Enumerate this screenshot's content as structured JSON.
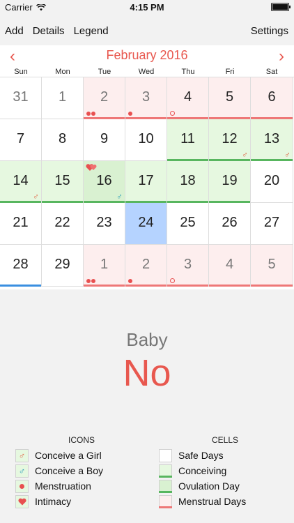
{
  "status": {
    "carrier": "Carrier",
    "time": "4:15 PM"
  },
  "nav": {
    "add": "Add",
    "details": "Details",
    "legend": "Legend",
    "settings": "Settings"
  },
  "calendar": {
    "month_title": "February 2016",
    "weekdays": [
      "Sun",
      "Mon",
      "Tue",
      "Wed",
      "Thu",
      "Fri",
      "Sat"
    ],
    "days": [
      {
        "n": "31",
        "type": "safe",
        "current": false
      },
      {
        "n": "1",
        "type": "safe",
        "current": false
      },
      {
        "n": "2",
        "type": "menstrual",
        "current": false,
        "dots": "two",
        "bar": "red"
      },
      {
        "n": "3",
        "type": "menstrual",
        "current": false,
        "dots": "one",
        "bar": "red"
      },
      {
        "n": "4",
        "type": "menstrual",
        "current": true,
        "dots": "hollow",
        "bar": "red"
      },
      {
        "n": "5",
        "type": "menstrual",
        "current": true,
        "bar": "red"
      },
      {
        "n": "6",
        "type": "menstrual",
        "current": true,
        "bar": "red"
      },
      {
        "n": "7",
        "type": "safe",
        "current": true
      },
      {
        "n": "8",
        "type": "safe",
        "current": true
      },
      {
        "n": "9",
        "type": "safe",
        "current": true
      },
      {
        "n": "10",
        "type": "safe",
        "current": true
      },
      {
        "n": "11",
        "type": "conceiving",
        "current": true,
        "bar": "green"
      },
      {
        "n": "12",
        "type": "conceiving",
        "current": true,
        "bar": "green",
        "gender": "girl"
      },
      {
        "n": "13",
        "type": "conceiving",
        "current": true,
        "bar": "green",
        "gender": "girl"
      },
      {
        "n": "14",
        "type": "conceiving",
        "current": true,
        "bar": "green",
        "gender": "girl"
      },
      {
        "n": "15",
        "type": "conceiving",
        "current": true,
        "bar": "green"
      },
      {
        "n": "16",
        "type": "ovulation",
        "current": true,
        "bar": "green",
        "gender": "boy",
        "hearts": true
      },
      {
        "n": "17",
        "type": "conceiving",
        "current": true,
        "bar": "green"
      },
      {
        "n": "18",
        "type": "conceiving",
        "current": true,
        "bar": "green"
      },
      {
        "n": "19",
        "type": "conceiving",
        "current": true,
        "bar": "green"
      },
      {
        "n": "20",
        "type": "safe",
        "current": true
      },
      {
        "n": "21",
        "type": "safe",
        "current": true
      },
      {
        "n": "22",
        "type": "safe",
        "current": true
      },
      {
        "n": "23",
        "type": "safe",
        "current": true
      },
      {
        "n": "24",
        "type": "today",
        "current": true
      },
      {
        "n": "25",
        "type": "safe",
        "current": true
      },
      {
        "n": "26",
        "type": "safe",
        "current": true
      },
      {
        "n": "27",
        "type": "safe",
        "current": true
      },
      {
        "n": "28",
        "type": "safe",
        "current": true,
        "bar": "blue",
        "bold": true
      },
      {
        "n": "29",
        "type": "safe",
        "current": true
      },
      {
        "n": "1",
        "type": "menstrual",
        "current": false,
        "dots": "two",
        "bar": "red"
      },
      {
        "n": "2",
        "type": "menstrual",
        "current": false,
        "dots": "one",
        "bar": "red"
      },
      {
        "n": "3",
        "type": "menstrual",
        "current": false,
        "dots": "hollow",
        "bar": "red"
      },
      {
        "n": "4",
        "type": "menstrual",
        "current": false,
        "bar": "red"
      },
      {
        "n": "5",
        "type": "menstrual",
        "current": false,
        "bar": "red"
      }
    ]
  },
  "baby": {
    "label": "Baby",
    "value": "No"
  },
  "legend": {
    "icons_header": "ICONS",
    "cells_header": "CELLS",
    "icons": [
      {
        "label": "Conceive a Girl",
        "icon": "female-symbol-icon"
      },
      {
        "label": "Conceive a Boy",
        "icon": "male-symbol-icon"
      },
      {
        "label": "Menstruation",
        "icon": "dot-icon"
      },
      {
        "label": "Intimacy",
        "icon": "heart-icon"
      }
    ],
    "cells": [
      {
        "label": "Safe Days",
        "style": "safe"
      },
      {
        "label": "Conceiving",
        "style": "conceiving"
      },
      {
        "label": "Ovulation Day",
        "style": "ovulation"
      },
      {
        "label": "Menstrual Days",
        "style": "menstrual"
      }
    ]
  },
  "colors": {
    "accent": "#e8584f",
    "green": "#58b65f",
    "today": "#b5d3ff"
  }
}
